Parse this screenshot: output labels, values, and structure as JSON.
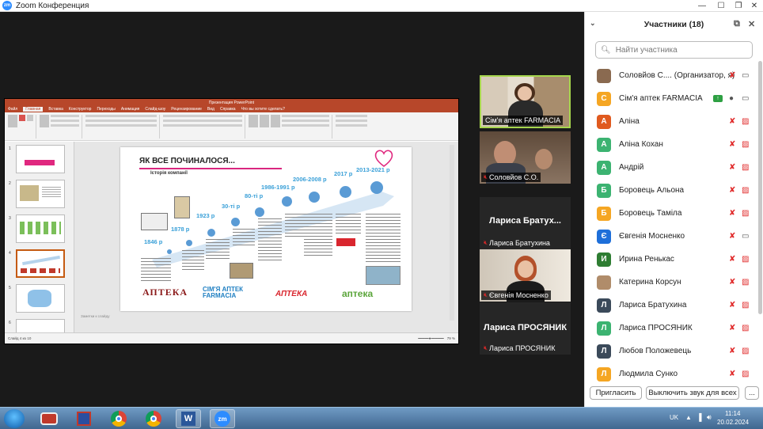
{
  "window": {
    "title": "Zoom Конференция",
    "logo_text": "zm"
  },
  "share": {
    "ppt_title": "Презентация PowerPoint",
    "ribbon_tabs": [
      "Файл",
      "Главная",
      "Вставка",
      "Конструктор",
      "Переходы",
      "Анимация",
      "Слайд-шоу",
      "Рецензирование",
      "Вид",
      "Справка",
      "Что вы хотите сделать?"
    ],
    "slide": {
      "title": "ЯК ВСЕ ПОЧИНАЛОСЯ...",
      "subtitle": "Історія компанії",
      "years": [
        "1846 р",
        "1878 р",
        "1923 р",
        "30-ті р",
        "80-ті р",
        "1986-1991 р",
        "2006-2008 р",
        "2017 р",
        "2013-2021 р"
      ],
      "brands": [
        "АПТЕКА",
        "СІМ'Я АПТЕК FARMACIA",
        "АПТЕКА",
        "аптека"
      ]
    },
    "status_text": "Слайд 4 из 10",
    "notes_placeholder": "Заметки к слайду",
    "zoom_level": "79 %"
  },
  "tiles": [
    {
      "name": "Сім'я аптек FARMACIA",
      "big": "",
      "muted": false
    },
    {
      "name": "Соловйов С.О.",
      "big": "",
      "muted": true
    },
    {
      "name": "Лариса Братухина",
      "big": "Лариса Братух...",
      "muted": true
    },
    {
      "name": "Євгенія Мосненко",
      "big": "",
      "muted": true
    },
    {
      "name": "Лариса ПРОСЯНИК",
      "big": "Лариса ПРОСЯНИК",
      "muted": true
    }
  ],
  "panel": {
    "title": "Участники (18)",
    "search_placeholder": "Найти участника",
    "participants": [
      {
        "initial": "",
        "name": "Соловйов С....  (Организатор, я)",
        "color": "#8a6a50",
        "mic": "muted",
        "cam": "on"
      },
      {
        "initial": "С",
        "name": "Сім'я аптек FARMACIA",
        "color": "#f5a623",
        "mic": "on",
        "cam": "on"
      },
      {
        "initial": "А",
        "name": "Аліна",
        "color": "#e05a1f",
        "mic": "muted",
        "cam": "off"
      },
      {
        "initial": "А",
        "name": "Аліна Кохан",
        "color": "#3cb371",
        "mic": "muted",
        "cam": "off"
      },
      {
        "initial": "А",
        "name": "Андрій",
        "color": "#3cb371",
        "mic": "muted",
        "cam": "off"
      },
      {
        "initial": "Б",
        "name": "Боровець Альона",
        "color": "#3cb371",
        "mic": "muted",
        "cam": "off"
      },
      {
        "initial": "Б",
        "name": "Боровець Таміла",
        "color": "#f5a623",
        "mic": "muted",
        "cam": "off"
      },
      {
        "initial": "Є",
        "name": "Євгенія Мосненко",
        "color": "#1e6fd9",
        "mic": "muted",
        "cam": "on"
      },
      {
        "initial": "И",
        "name": "Ирина Ренькас",
        "color": "#2e7d32",
        "mic": "muted",
        "cam": "off"
      },
      {
        "initial": "",
        "name": "Катерина Корсун",
        "color": "#b08c6a",
        "mic": "muted",
        "cam": "off"
      },
      {
        "initial": "Л",
        "name": "Лариса Братухина",
        "color": "#3b4a5a",
        "mic": "muted",
        "cam": "off"
      },
      {
        "initial": "Л",
        "name": "Лариса ПРОСЯНИК",
        "color": "#3cb371",
        "mic": "muted",
        "cam": "off"
      },
      {
        "initial": "Л",
        "name": "Любов Положевець",
        "color": "#3b4a5a",
        "mic": "muted",
        "cam": "off"
      },
      {
        "initial": "Л",
        "name": "Людмила Сунко",
        "color": "#f5a623",
        "mic": "muted",
        "cam": "off"
      }
    ],
    "invite_label": "Пригласить",
    "mute_all_label": "Выключить звук для всех",
    "more_label": "..."
  },
  "taskbar": {
    "lang": "UK",
    "time": "11:14",
    "date": "20.02.2024",
    "zoom_app_label": "zm"
  },
  "colors": {
    "zoom_blue": "#2d8cff",
    "ppt_red": "#b7472a",
    "active_speaker": "#a6d64d",
    "muted_red": "#e02828"
  }
}
